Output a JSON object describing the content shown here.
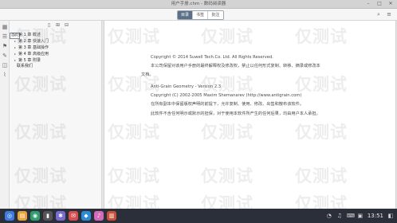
{
  "window": {
    "title": "用户手册.chm - 数码阅读器",
    "controls": [
      "–",
      "□",
      "✕"
    ]
  },
  "toolbar": {
    "tabs": [
      {
        "label": "目录",
        "active": true
      },
      {
        "label": "书签",
        "active": false
      },
      {
        "label": "批注",
        "active": false
      }
    ]
  },
  "sidebar": {
    "current_label": "首页",
    "items": [
      {
        "label": "第 1 章  概述",
        "expanded": true
      },
      {
        "label": "第 2 章  快速入门",
        "expanded": true
      },
      {
        "label": "第 3 章  基础操作",
        "expanded": true
      },
      {
        "label": "第 4 章  高级应用",
        "expanded": true
      },
      {
        "label": "第 5 章  附录",
        "expanded": true
      },
      {
        "label": "联系我们",
        "expanded": false
      }
    ]
  },
  "document": {
    "lines": [
      "Copyright © 2014 Suwell Tech.Co. Ltd. All Rights Reserved.",
      "本公司保留对该用户手册的最终解释权及修改权，禁止以任何形式复制、转移、摘录或修改本",
      "文档。",
      "Anti-Grain Geometry - Version 2.3",
      "Copyright (C) 2002-2005 Maxim Shemanarev (http://www.antigrain.com)",
      "在所有副本中保留版权声明的前提下，允许复制、使用、修改、出售和散布该软件。",
      "此软件不含任何明示或默示的担保，对于使用本软件所产生的任何后果，均由用户本人承担。"
    ]
  },
  "watermarks": [
    "仅测试",
    "仅测试",
    "仅测试",
    "仅测试",
    "仅测试",
    "仅测试",
    "仅测试",
    "仅测试",
    "仅测试",
    "仅测试",
    "仅测试",
    "仅测试",
    "仅测试",
    "仅测试",
    "仅测试",
    "仅测试",
    "仅测试",
    "仅测试",
    "仅测试",
    "仅测试"
  ],
  "taskbar": {
    "apps": [
      {
        "icon": "launcher-icon",
        "color": "#3d7be0",
        "glyph": "◎"
      },
      {
        "icon": "file-manager-icon",
        "color": "#e8a33b",
        "glyph": "▤"
      },
      {
        "icon": "browser-icon",
        "color": "#2f9e6f",
        "glyph": "◉"
      },
      {
        "icon": "terminal-icon",
        "color": "#555555",
        "glyph": "▮"
      },
      {
        "icon": "settings-icon",
        "color": "#7a6ccf",
        "glyph": "✱"
      },
      {
        "icon": "mail-icon",
        "color": "#d44f4f",
        "glyph": "✉"
      },
      {
        "icon": "store-icon",
        "color": "#2a8bd6",
        "glyph": "◆"
      },
      {
        "icon": "music-icon",
        "color": "#d46ab8",
        "glyph": "♪"
      },
      {
        "icon": "reader-icon",
        "color": "#c8503a",
        "glyph": "▥"
      }
    ],
    "clock": "13:51"
  }
}
